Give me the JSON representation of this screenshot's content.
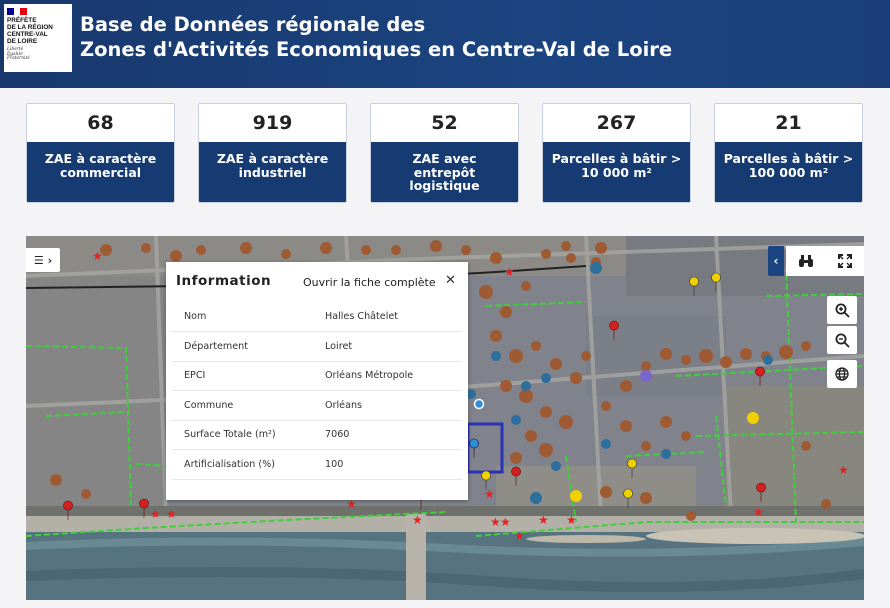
{
  "header": {
    "logo": {
      "lines": [
        "PRÉFÈTE",
        "DE LA RÉGION",
        "CENTRE-VAL",
        "DE LOIRE"
      ],
      "motto": [
        "Liberté",
        "Égalité",
        "Fraternité"
      ]
    },
    "title_line1": "Base de Données régionale des",
    "title_line2": "Zones d'Activités Economiques en Centre-Val de Loire"
  },
  "stats": [
    {
      "value": "68",
      "label_lines": [
        "ZAE à caractère",
        "commercial"
      ]
    },
    {
      "value": "919",
      "label_lines": [
        "ZAE à caractère",
        "industriel"
      ]
    },
    {
      "value": "52",
      "label_lines": [
        "ZAE avec",
        "entrepôt",
        "logistique"
      ]
    },
    {
      "value": "267",
      "label_lines": [
        "Parcelles à bâtir >",
        "10 000 m²"
      ]
    },
    {
      "value": "21",
      "label_lines": [
        "Parcelles à bâtir >",
        "100 000 m²"
      ]
    }
  ],
  "popup": {
    "title": "Information",
    "link": "Ouvrir la fiche complète",
    "close": "✕",
    "rows": [
      {
        "key": "Nom",
        "value": "Halles Châtelet"
      },
      {
        "key": "Département",
        "value": "Loiret"
      },
      {
        "key": "EPCI",
        "value": "Orléans Métropole"
      },
      {
        "key": "Commune",
        "value": "Orléans"
      },
      {
        "key": "Surface Totale (m²)",
        "value": "7060"
      },
      {
        "key": "Artificialisation (%)",
        "value": "100"
      }
    ]
  },
  "controls": {
    "layers": "☰ ›",
    "collapse": "‹",
    "binoculars_icon": "binoculars-icon",
    "fullscreen_icon": "fullscreen-icon",
    "zoom_in_icon": "zoom-in-icon",
    "zoom_out_icon": "zoom-out-icon",
    "globe_icon": "globe-icon"
  },
  "colors": {
    "header_bg": "#18386d",
    "card_label_bg": "#163b72",
    "marker_brown": "#a0582e",
    "marker_blue": "#2c6f9c",
    "marker_red": "#d42020",
    "marker_yellow": "#f0d000",
    "marker_purple": "#7a66c8",
    "boundary_green": "#3ed03a",
    "selection_blue": "#2a32b8"
  }
}
